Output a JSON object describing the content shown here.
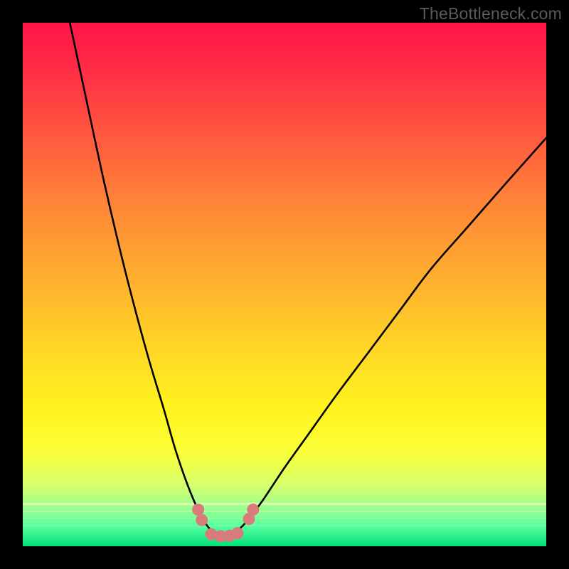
{
  "watermark": "TheBottleneck.com",
  "chart_data": {
    "type": "line",
    "title": "",
    "xlabel": "",
    "ylabel": "",
    "xlim": [
      0,
      100
    ],
    "ylim": [
      0,
      100
    ],
    "grid": false,
    "legend": false,
    "series": [
      {
        "name": "bottleneck-curve",
        "x": [
          9,
          12,
          15,
          18,
          21,
          24,
          27,
          29,
          31,
          33,
          34.5,
          36,
          37.5,
          39,
          41,
          43,
          46,
          50,
          55,
          60,
          66,
          72,
          78,
          85,
          92,
          100
        ],
        "y": [
          100,
          86,
          72,
          59,
          47,
          36,
          26,
          19,
          13,
          8,
          5,
          3,
          2,
          2,
          3,
          5,
          9,
          15,
          22,
          29,
          37,
          45,
          53,
          61,
          69,
          78
        ]
      }
    ],
    "markers": {
      "name": "highlight-dots",
      "color": "#d97b7b",
      "points": [
        {
          "x": 33.5,
          "y": 7
        },
        {
          "x": 34.2,
          "y": 5
        },
        {
          "x": 36.0,
          "y": 2.3
        },
        {
          "x": 37.8,
          "y": 1.9
        },
        {
          "x": 39.5,
          "y": 2.0
        },
        {
          "x": 41.0,
          "y": 2.5
        },
        {
          "x": 43.2,
          "y": 5.2
        },
        {
          "x": 44.0,
          "y": 7.0
        }
      ]
    },
    "background_gradient": {
      "top": "#ff1648",
      "mid": "#ffd626",
      "bottom": "#00e27a"
    }
  }
}
